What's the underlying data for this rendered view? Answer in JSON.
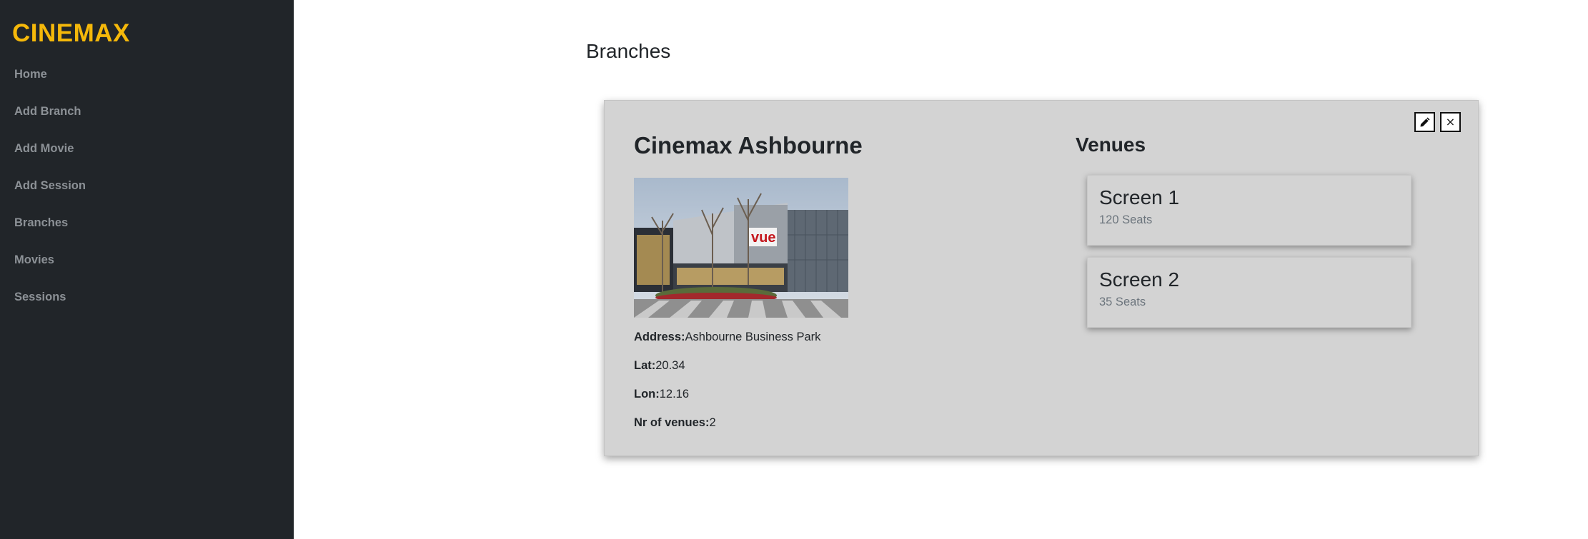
{
  "app": {
    "brand": "CINEMAX"
  },
  "sidebar": {
    "items": [
      {
        "label": "Home"
      },
      {
        "label": "Add Branch"
      },
      {
        "label": "Add Movie"
      },
      {
        "label": "Add Session"
      },
      {
        "label": "Branches"
      },
      {
        "label": "Movies"
      },
      {
        "label": "Sessions"
      }
    ]
  },
  "main": {
    "title": "Branches"
  },
  "branch": {
    "name": "Cinemax Ashbourne",
    "image_alt": "Cinema building exterior",
    "address_label": "Address:",
    "address": "Ashbourne Business Park",
    "lat_label": "Lat:",
    "lat": "20.34",
    "lon_label": "Lon:",
    "lon": "12.16",
    "venues_count_label": "Nr of venues:",
    "venues_count": "2",
    "building_sign": "vue"
  },
  "venues": {
    "title": "Venues",
    "items": [
      {
        "name": "Screen 1",
        "seats": "120 Seats"
      },
      {
        "name": "Screen 2",
        "seats": "35 Seats"
      }
    ]
  },
  "actions": {
    "edit_icon": "pencil-icon",
    "close_icon": "close-icon",
    "close_glyph": "×"
  },
  "colors": {
    "sidebar_bg": "#212529",
    "brand": "#f5b80a",
    "card_bg": "#d3d3d3"
  }
}
